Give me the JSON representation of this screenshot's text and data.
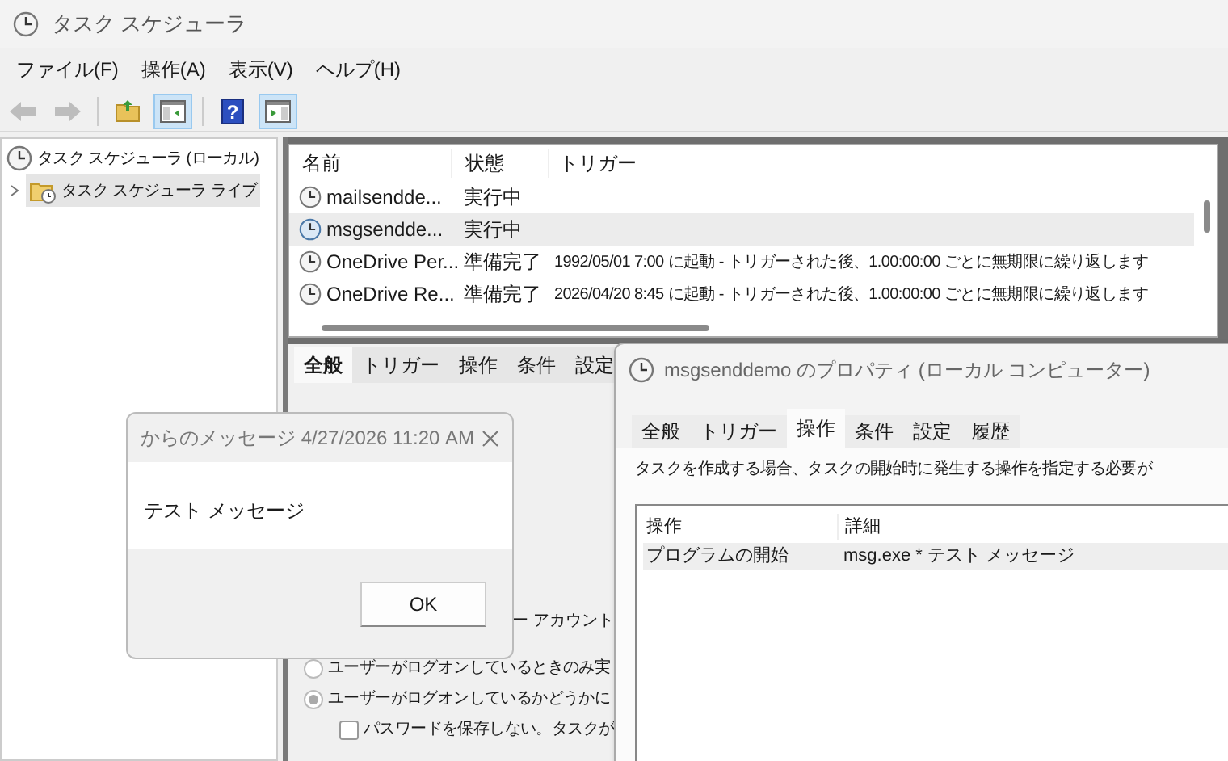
{
  "window": {
    "title": "タスク スケジューラ"
  },
  "menu": [
    "ファイル(F)",
    "操作(A)",
    "表示(V)",
    "ヘルプ(H)"
  ],
  "toolbar": [
    {
      "kind": "back",
      "disabled": true,
      "pressed": false
    },
    {
      "kind": "forward",
      "disabled": true,
      "pressed": false
    },
    {
      "kind": "folder-up",
      "disabled": false,
      "pressed": false
    },
    {
      "kind": "tree-pane",
      "disabled": false,
      "pressed": true
    },
    {
      "kind": "help",
      "glyph": "?",
      "disabled": false,
      "pressed": false
    },
    {
      "kind": "action-pane",
      "disabled": false,
      "pressed": true
    }
  ],
  "tree": [
    {
      "label": "タスク スケジューラ (ローカル)",
      "selected": false,
      "children": [
        {
          "label": "タスク スケジューラ ライブ",
          "expanded": false,
          "selected": true
        }
      ]
    }
  ],
  "task_list": {
    "columns": [
      "名前",
      "状態",
      "トリガー"
    ],
    "rows": [
      {
        "name": "mailsendde...",
        "status": "実行中",
        "selected": false
      },
      {
        "name": "msgsendde...",
        "status": "実行中",
        "selected": true
      },
      {
        "name": "OneDrive Per...",
        "status": "準備完了",
        "trigger": "1992/05/01 7:00 に起動 - トリガーされた後、1.00:00:00 ごとに無期限に繰り返します",
        "selected": false
      },
      {
        "name": "OneDrive Re...",
        "status": "準備完了",
        "trigger": "2026/04/20 8:45 に起動 - トリガーされた後、1.00:00:00 ごとに無期限に繰り返します",
        "selected": false
      }
    ]
  },
  "details_pane": {
    "tabs": [
      {
        "label": "全般",
        "selected": true
      },
      {
        "label": "トリガー",
        "selected": false
      },
      {
        "label": "操作",
        "selected": false
      },
      {
        "label": "条件",
        "selected": false
      },
      {
        "label": "設定",
        "selected": false
      }
    ],
    "account_label": "ー アカウント",
    "options": [
      {
        "kind": "radio",
        "label": "ユーザーがログオンしているときのみ実",
        "checked": false
      },
      {
        "kind": "radio",
        "label": "ユーザーがログオンしているかどうかに",
        "checked": true
      },
      {
        "kind": "checkbox",
        "label": "パスワードを保存しない。タスクが",
        "checked": false
      }
    ]
  },
  "message_box": {
    "title": "からのメッセージ 4/27/2026 11:20 AM",
    "message": "テスト メッセージ",
    "button": "OK"
  },
  "properties": {
    "title": "msgsenddemo のプロパティ (ローカル コンピューター)",
    "tabs": [
      {
        "label": "全般",
        "selected": false
      },
      {
        "label": "トリガー",
        "selected": false
      },
      {
        "label": "操作",
        "selected": true
      },
      {
        "label": "条件",
        "selected": false
      },
      {
        "label": "設定",
        "selected": false
      },
      {
        "label": "履歴",
        "selected": false
      }
    ],
    "description": "タスクを作成する場合、タスクの開始時に発生する操作を指定する必要が",
    "columns": [
      "操作",
      "詳細"
    ],
    "rows": [
      {
        "action": "プログラムの開始",
        "details": "msg.exe * テスト メッセージ",
        "selected": true
      }
    ]
  }
}
